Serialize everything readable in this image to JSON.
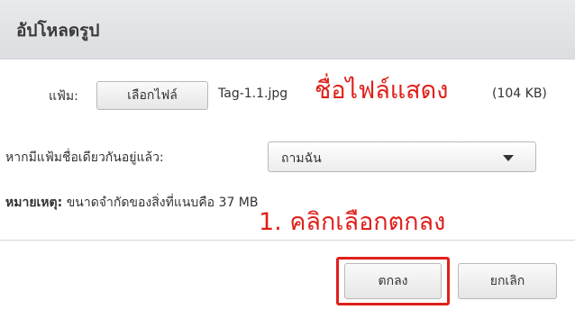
{
  "dialog": {
    "title": "อัปโหลดรูป"
  },
  "file_row": {
    "label": "แฟ้ม:",
    "choose_button_label": "เลือกไฟล์",
    "file_name": "Tag-1.1.jpg",
    "file_size": "(104 KB)"
  },
  "exists_row": {
    "label": "หากมีแฟ้มชื่อเดียวกันอยู่แล้ว:",
    "selected_option": "ถามฉัน"
  },
  "note": {
    "label": "หมายเหตุ:",
    "text": "ขนาดจำกัดของสิ่งที่แนบคือ 37 MB"
  },
  "buttons": {
    "ok_label": "ตกลง",
    "cancel_label": "ยกเลิก"
  },
  "annotations": {
    "filename_callout": "ชื่อไฟล์แสดง",
    "step_callout": "1. คลิกเลือกตกลง",
    "color": "#e0201b"
  },
  "icons": {
    "select_caret": "caret-down-icon"
  }
}
